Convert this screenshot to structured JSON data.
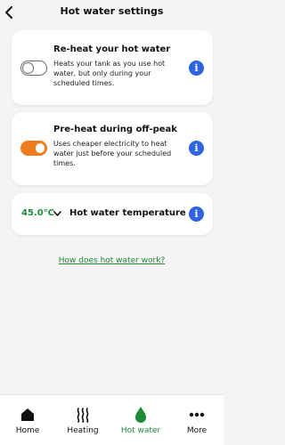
{
  "header": {
    "title": "Hot water settings"
  },
  "cards": [
    {
      "title": "Re-heat your hot water",
      "description": "Heats your tank as you use hot water, but only during your scheduled times.",
      "toggle_state": "off"
    },
    {
      "title": "Pre-heat during off-peak",
      "description": "Uses cheaper electricity to heat water just before your scheduled times.",
      "toggle_state": "on"
    }
  ],
  "temperature": {
    "value": "45.0°C",
    "label": "Hot water temperature"
  },
  "help_link": "How does hot water work?",
  "nav": {
    "items": [
      {
        "label": "Home",
        "icon": "home-icon"
      },
      {
        "label": "Heating",
        "icon": "heating-icon"
      },
      {
        "label": "Hot water",
        "icon": "water-drop-icon"
      },
      {
        "label": "More",
        "icon": "more-icon"
      }
    ],
    "active": "Hot water"
  },
  "colors": {
    "accent_green": "#1d8a38",
    "toggle_on": "#ef7d1f",
    "info_blue": "#2f63e0"
  }
}
